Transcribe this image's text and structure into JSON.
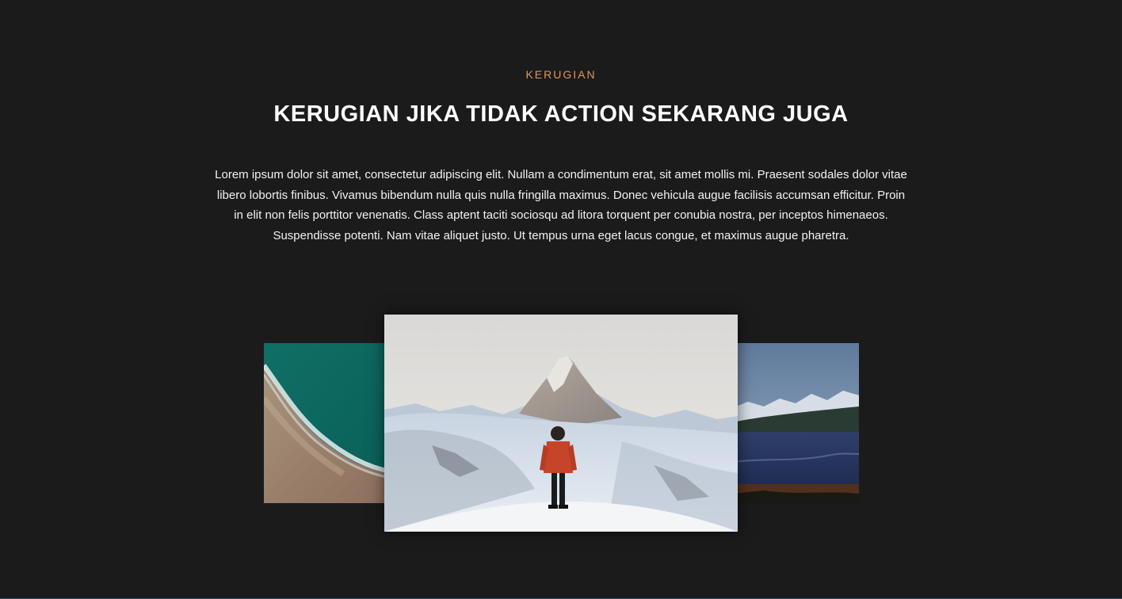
{
  "section": {
    "eyebrow": "KERUGIAN",
    "title": "KERUGIAN JIKA TIDAK ACTION SEKARANG JUGA",
    "body": "Lorem ipsum dolor sit amet, consectetur adipiscing elit. Nullam a condimentum erat, sit amet mollis mi. Praesent sodales dolor vitae libero lobortis finibus. Vivamus bibendum nulla quis nulla fringilla maximus. Donec vehicula augue facilisis accumsan efficitur. Proin in elit non felis porttitor venenatis. Class aptent taciti sociosqu ad litora torquent per conubia nostra, per inceptos himenaeos. Suspendisse potenti. Nam vitae aliquet justo. Ut tempus urna eget lacus congue, et maximus augue pharetra."
  },
  "colors": {
    "background": "#1b1b1b",
    "accent": "#e2945a",
    "text": "#ffffff"
  },
  "carousel": {
    "slides": [
      {
        "scene": "aerial-beach-coastline"
      },
      {
        "scene": "hiker-snowy-mountain-peak"
      },
      {
        "scene": "mountain-lake-landscape"
      }
    ],
    "active_index": 1
  }
}
